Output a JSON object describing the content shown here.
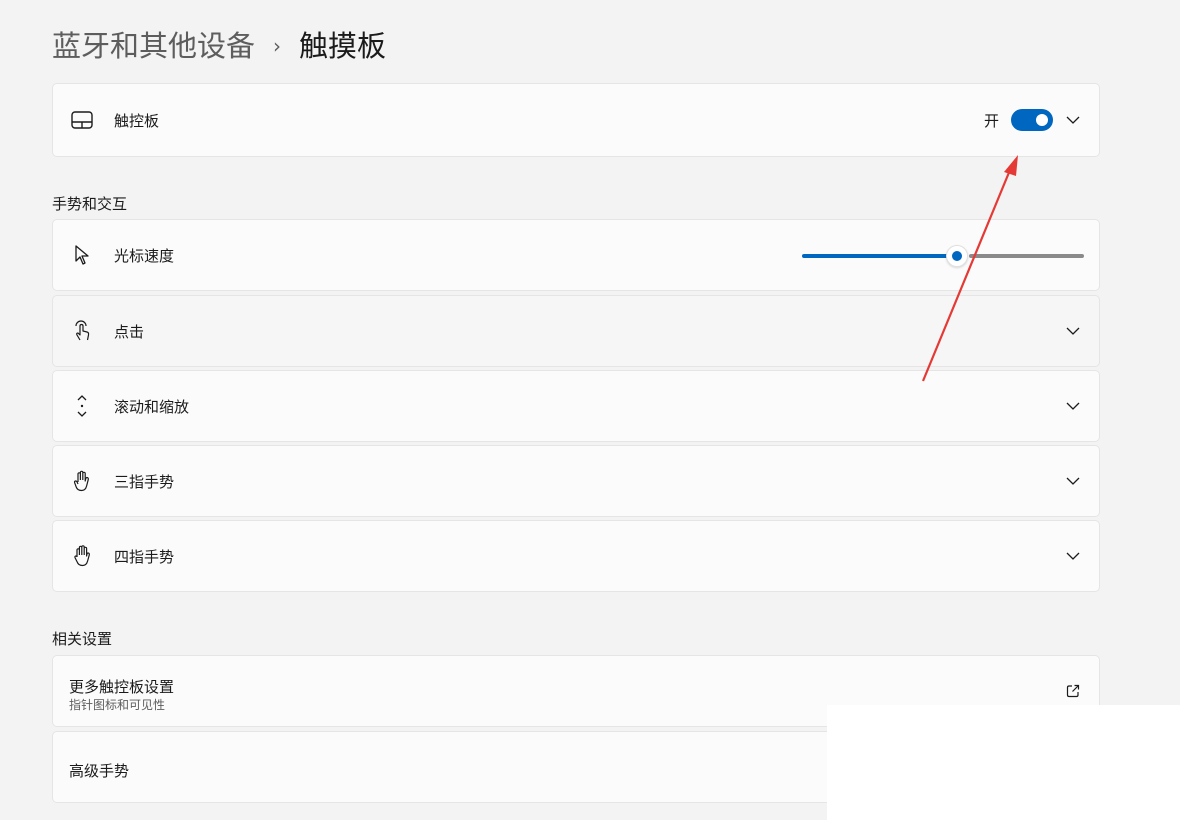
{
  "breadcrumb": {
    "parent": "蓝牙和其他设备",
    "separator": "›",
    "current": "触摸板"
  },
  "touchpad_card": {
    "label": "触控板",
    "icon": "touchpad-icon",
    "toggle_text": "开",
    "toggle_on": true
  },
  "gestures_section": {
    "title": "手势和交互",
    "items": [
      {
        "label": "光标速度",
        "icon": "cursor-icon",
        "slider_value": 0.55
      },
      {
        "label": "点击",
        "icon": "tap-icon"
      },
      {
        "label": "滚动和缩放",
        "icon": "scroll-icon"
      },
      {
        "label": "三指手势",
        "icon": "hand-icon"
      },
      {
        "label": "四指手势",
        "icon": "hand-icon"
      }
    ]
  },
  "related_section": {
    "title": "相关设置",
    "items": [
      {
        "title": "更多触控板设置",
        "subtitle": "指针图标和可见性",
        "icon": "external-link-icon"
      },
      {
        "title": "高级手势"
      }
    ]
  },
  "colors": {
    "accent": "#0067c0",
    "annotation_arrow": "#e53935",
    "background": "#f3f3f3",
    "card": "#fbfbfb"
  }
}
